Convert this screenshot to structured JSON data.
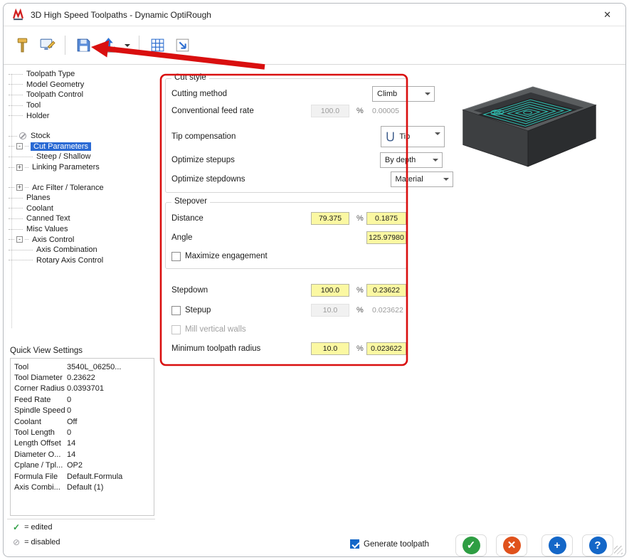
{
  "window": {
    "title": "3D High Speed Toolpaths - Dynamic OptiRough"
  },
  "symbols": {
    "close": "✕",
    "check": "✓",
    "disabled": "⊘"
  },
  "toolbar": {
    "icons": [
      "hammer-tool",
      "screen-edit",
      "save",
      "export",
      "grid-functions",
      "transfer-arrow"
    ]
  },
  "tree": {
    "items": [
      {
        "label": "Toolpath Type",
        "expand": ""
      },
      {
        "label": "Model Geometry",
        "expand": ""
      },
      {
        "label": "Toolpath Control",
        "expand": ""
      },
      {
        "label": "Tool",
        "expand": ""
      },
      {
        "label": "Holder",
        "expand": ""
      },
      {
        "label": "Stock",
        "expand": "",
        "icon": "disabled"
      },
      {
        "label": "Cut Parameters",
        "expand": "-",
        "selected": true
      },
      {
        "label": "Steep / Shallow",
        "expand": "",
        "depth": 1
      },
      {
        "label": "Linking Parameters",
        "expand": "+"
      },
      {
        "label": "Arc Filter / Tolerance",
        "expand": "+"
      },
      {
        "label": "Planes",
        "expand": ""
      },
      {
        "label": "Coolant",
        "expand": ""
      },
      {
        "label": "Canned Text",
        "expand": ""
      },
      {
        "label": "Misc Values",
        "expand": ""
      },
      {
        "label": "Axis Control",
        "expand": "-"
      },
      {
        "label": "Axis Combination",
        "expand": "",
        "depth": 1
      },
      {
        "label": "Rotary Axis Control",
        "expand": "",
        "depth": 1
      }
    ]
  },
  "quick_view": {
    "title": "Quick View Settings",
    "rows": [
      {
        "label": "Tool",
        "value": "3540L_06250..."
      },
      {
        "label": "Tool Diameter",
        "value": "0.23622"
      },
      {
        "label": "Corner Radius",
        "value": "0.0393701"
      },
      {
        "label": "Feed Rate",
        "value": "0"
      },
      {
        "label": "Spindle Speed",
        "value": "0"
      },
      {
        "label": "Coolant",
        "value": "Off"
      },
      {
        "label": "Tool Length",
        "value": "0"
      },
      {
        "label": "Length Offset",
        "value": "14"
      },
      {
        "label": "Diameter O...",
        "value": "14"
      },
      {
        "label": "Cplane / Tpl...",
        "value": "OP2"
      },
      {
        "label": "Formula File",
        "value": "Default.Formula"
      },
      {
        "label": "Axis Combi...",
        "value": "Default (1)"
      }
    ]
  },
  "legend": {
    "edited_text": "= edited",
    "disabled_text": "= disabled"
  },
  "form": {
    "percent": "%",
    "cut_style": {
      "title": "Cut style",
      "cutting_method": {
        "label": "Cutting method",
        "value": "Climb"
      },
      "conventional": {
        "label": "Conventional feed rate",
        "pct": "100.0",
        "value": "0.00005"
      },
      "tip": {
        "label": "Tip compensation",
        "value": "Tip"
      },
      "stepups": {
        "label": "Optimize stepups",
        "value": "By depth"
      },
      "stepdowns": {
        "label": "Optimize stepdowns",
        "value": "Material"
      }
    },
    "stepover": {
      "title": "Stepover",
      "distance": {
        "label": "Distance",
        "pct": "79.375",
        "value": "0.1875"
      },
      "angle": {
        "label": "Angle",
        "value": "125.97980"
      },
      "maximize_label": "Maximize engagement"
    },
    "stepdown": {
      "label": "Stepdown",
      "pct": "100.0",
      "value": "0.23622"
    },
    "stepup": {
      "label": "Stepup",
      "pct": "10.0",
      "value": "0.023622"
    },
    "mill_walls_label": "Mill vertical walls",
    "min_radius": {
      "label": "Minimum toolpath radius",
      "pct": "10.0",
      "value": "0.023622"
    }
  },
  "footer": {
    "generate_label": "Generate toolpath",
    "buttons": [
      {
        "name": "ok",
        "glyph": "✓"
      },
      {
        "name": "cancel",
        "glyph": "✕"
      },
      {
        "name": "plus",
        "glyph": "+"
      },
      {
        "name": "help",
        "glyph": "?"
      }
    ]
  },
  "colors": {
    "selection_blue": "#2a6ad4",
    "field_yellow": "#fbf8a2",
    "toolpath_teal": "#32c8ba",
    "annotation_red": "#d90f0f",
    "ok_green": "#2e9e43",
    "cancel_red": "#e0521c",
    "accent_blue": "#1467c8"
  }
}
